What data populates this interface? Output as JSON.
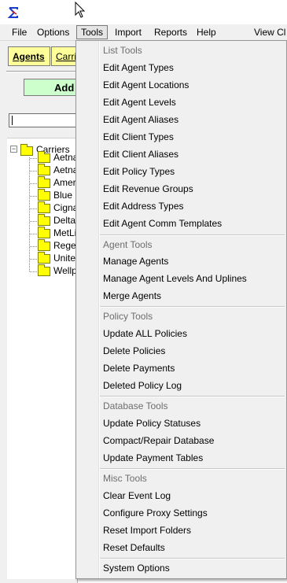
{
  "menubar": {
    "items": [
      "File",
      "Options",
      "Tools",
      "Import",
      "Reports",
      "Help",
      "View Cl"
    ]
  },
  "left": {
    "tabs": [
      "Agents",
      "Carriers"
    ],
    "add_label": "Add",
    "search_value": "",
    "tree": {
      "root": "Carriers",
      "children": [
        "Aetna",
        "Aetna",
        "Ameri",
        "Blue (",
        "Cigna",
        "Delta",
        "MetLi",
        "Rege",
        "United",
        "Wellp"
      ]
    }
  },
  "tools_menu": {
    "sections": [
      {
        "header": "List Tools",
        "items": [
          "Edit Agent Types",
          "Edit Agent Locations",
          "Edit Agent Levels",
          "Edit Agent Aliases",
          "Edit Client Types",
          "Edit Client Aliases",
          "Edit Policy Types",
          "Edit Revenue Groups",
          "Edit Address Types",
          "Edit Agent Comm Templates"
        ]
      },
      {
        "header": "Agent Tools",
        "items": [
          "Manage Agents",
          "Manage Agent Levels And Uplines",
          "Merge Agents"
        ]
      },
      {
        "header": "Policy Tools",
        "items": [
          "Update ALL Policies",
          "Delete Policies",
          "Delete Payments",
          "Deleted Policy Log"
        ]
      },
      {
        "header": "Database Tools",
        "items": [
          "Update Policy Statuses",
          "Compact/Repair Database",
          "Update Payment Tables"
        ]
      },
      {
        "header": "Misc Tools",
        "items": [
          "Clear Event Log",
          "Configure Proxy Settings",
          "Reset Import Folders",
          "Reset Defaults"
        ]
      },
      {
        "header": "",
        "items": [
          "System Options"
        ]
      }
    ]
  },
  "colors": {
    "tab_yellow": "#ffff99",
    "add_green": "#ccffcc",
    "folder_yellow": "#ffff00",
    "menu_bg": "#f0f0f0"
  },
  "icons": [
    "app-sigma-icon",
    "mouse-cursor-icon",
    "folder-icon",
    "collapse-icon"
  ]
}
